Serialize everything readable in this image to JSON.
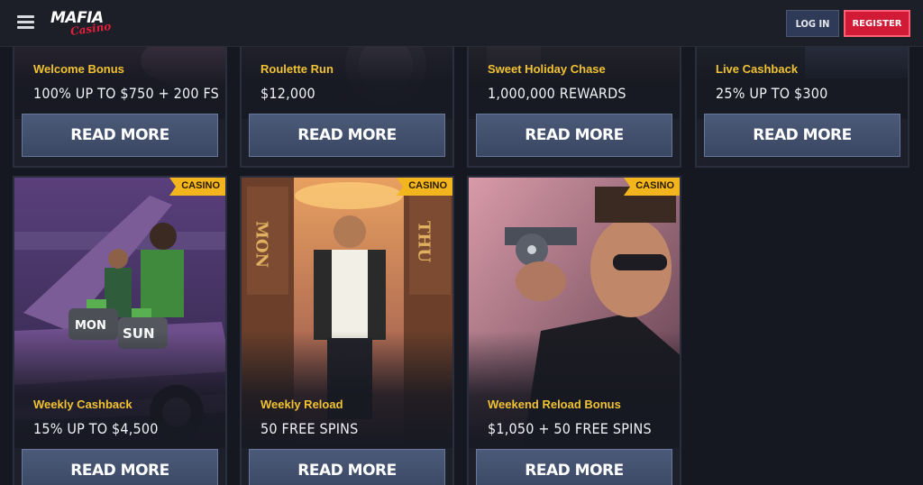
{
  "header": {
    "brand_word": "MAFIA",
    "brand_script": "Casino",
    "login_label": "LOG IN",
    "register_label": "REGISTER"
  },
  "colors": {
    "accent_gold": "#f1c232",
    "register_red": "#d01a36",
    "button_blue": "#3a4763",
    "badge_gold": "#f2b51d"
  },
  "top_row": [
    {
      "title": "Welcome Bonus",
      "offer": "100% UP TO $750 + 200 FS",
      "button": "READ MORE"
    },
    {
      "title": "Roulette Run",
      "offer": "$12,000",
      "button": "READ MORE"
    },
    {
      "title": "Sweet Holiday Chase",
      "offer": "1,000,000 REWARDS",
      "button": "READ MORE"
    },
    {
      "title": "Live Cashback",
      "offer": "25% UP TO $300",
      "button": "READ MORE"
    }
  ],
  "bottom_row": [
    {
      "badge": "CASINO",
      "title": "Weekly Cashback",
      "offer": "15% UP TO $4,500",
      "button": "READ MORE",
      "art_sign_a": "MON",
      "art_sign_b": "SUN"
    },
    {
      "badge": "CASINO",
      "title": "Weekly Reload",
      "offer": "50 FREE SPINS",
      "button": "READ MORE",
      "art_sign_a": "MON",
      "art_sign_b": "THU"
    },
    {
      "badge": "CASINO",
      "title": "Weekend Reload Bonus",
      "offer": "$1,050 + 50 FREE SPINS",
      "button": "READ MORE"
    }
  ]
}
